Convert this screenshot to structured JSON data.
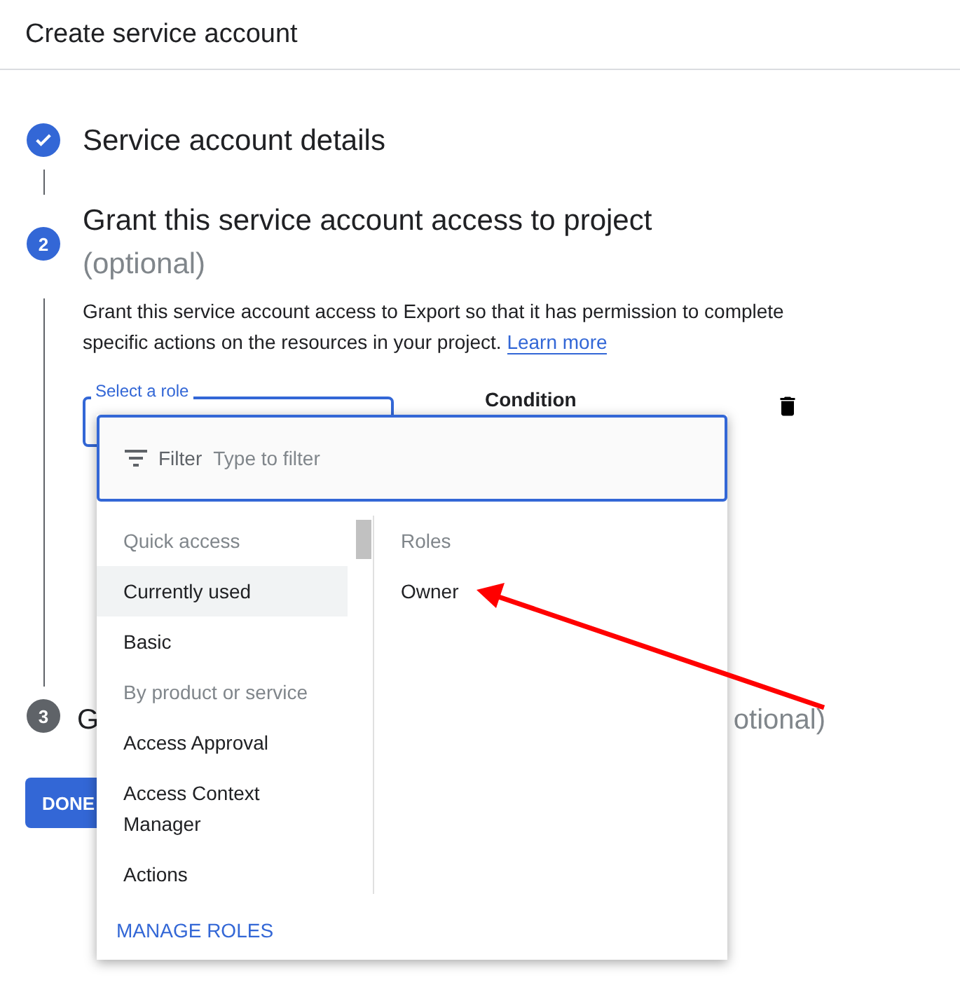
{
  "header": {
    "title": "Create service account"
  },
  "steps": [
    {
      "kind": "done",
      "title": "Service account details"
    },
    {
      "kind": "active",
      "number": "2",
      "title": "Grant this service account access to project",
      "optional": "(optional)",
      "description": "Grant this service account access to Export so that it has permission to complete specific actions on the resources in your project.",
      "link": "Learn more"
    },
    {
      "kind": "pending",
      "number": "3",
      "title_start": "G",
      "title_end": "otional)"
    }
  ],
  "role_field": {
    "label": "Select a role"
  },
  "condition": {
    "label": "Condition"
  },
  "done_button": "DONE",
  "dropdown": {
    "filter_label": "Filter",
    "placeholder": "Type to filter",
    "categories": [
      {
        "kind": "heading",
        "label": "Quick access"
      },
      {
        "kind": "item",
        "label": "Currently used",
        "selected": true
      },
      {
        "kind": "item",
        "label": "Basic",
        "selected": false
      },
      {
        "kind": "heading",
        "label": "By product or service"
      },
      {
        "kind": "item",
        "label": "Access Approval",
        "selected": false
      },
      {
        "kind": "item",
        "label": "Access Context Manager",
        "selected": false
      },
      {
        "kind": "item",
        "label": "Actions",
        "selected": false
      }
    ],
    "roles_heading": "Roles",
    "roles": [
      {
        "label": "Owner"
      }
    ],
    "manage_link": "MANAGE ROLES"
  }
}
